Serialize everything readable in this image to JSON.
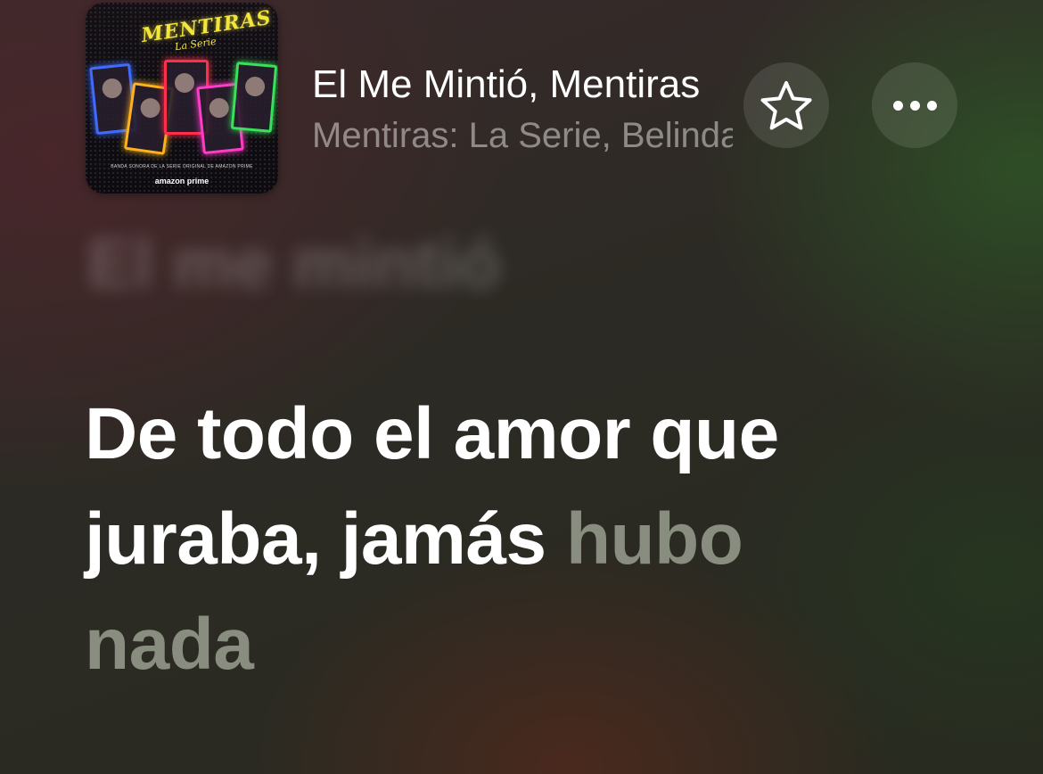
{
  "now_playing": {
    "title": "El Me Mintió, Mentiras",
    "artist": "Mentiras: La Serie, Belinda",
    "artwork": {
      "logo_text": "MENTIRAS",
      "logo_sub": "La Serie",
      "caption": "BANDA SONORA DE LA SERIE ORIGINAL DE AMAZON PRIME",
      "brand": "amazon prime"
    },
    "favorite_icon": "star-outline-icon",
    "more_icon": "ellipsis-icon"
  },
  "lyrics": {
    "previous_line": "El me mintió",
    "current": {
      "line1_sung": "De todo el amor que",
      "line2_sung": "juraba, jamás ",
      "line2_unsung": "hubo",
      "line3_unsung": "nada"
    }
  },
  "colors": {
    "text_primary": "#ffffff",
    "text_secondary": "rgba(255,255,255,0.45)",
    "lyric_unsung": "rgba(230,240,220,0.5)"
  }
}
